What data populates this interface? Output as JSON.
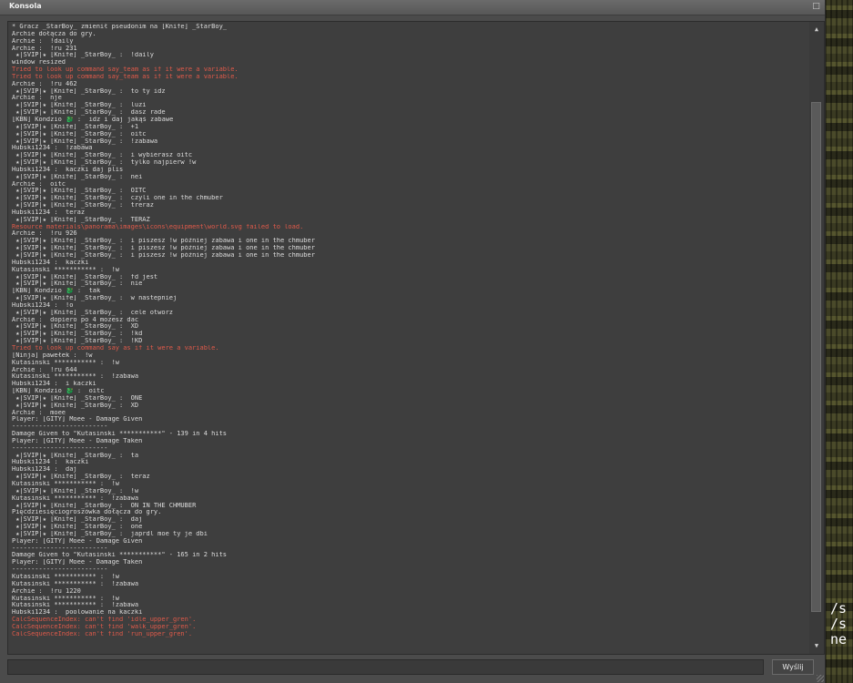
{
  "window": {
    "title": "Konsola",
    "close_icon": "□",
    "submit_label": "Wyślij",
    "input_value": ""
  },
  "game": {
    "text": "/s\n/s\nne"
  },
  "scrollbar": {
    "up_icon": "▲",
    "down_icon": "▼",
    "position_fraction": 0.85
  },
  "colors": {
    "error": "#e05a4a",
    "normal": "#dcdcdc"
  },
  "log": [
    {
      "t": "* Gracz _StarBoy_ zmienił pseudonim na [Knife] _StarBoy_",
      "e": false
    },
    {
      "t": "Archie dołącza do gry.",
      "e": false
    },
    {
      "t": "Archie :  !daily",
      "e": false
    },
    {
      "t": "Archie :  !ru 231",
      "e": false
    },
    {
      "t": " ★|SVIP|★ [Knife] _StarBoy_ :  !daily",
      "e": false
    },
    {
      "t": "window resized",
      "e": false
    },
    {
      "t": "Tried to look up command say_team as if it were a variable.",
      "e": true
    },
    {
      "t": "Tried to look up command say_team as if it were a variable.",
      "e": true
    },
    {
      "t": "Archie :  !ru 462",
      "e": false
    },
    {
      "t": " ★|SVIP|★ [Knife] _StarBoy_ :  to ty idz",
      "e": false
    },
    {
      "t": "Archie :  nje",
      "e": false
    },
    {
      "t": " ★|SVIP|★ [Knife] _StarBoy_ :  luzi",
      "e": false
    },
    {
      "t": " ★|SVIP|★ [Knife] _StarBoy_ :  dasz rade",
      "e": false
    },
    {
      "t": "[KBN] Kondzio 🐉 :  idz i daj jakąś zabawe",
      "e": false
    },
    {
      "t": " ★|SVIP|★ [Knife] _StarBoy_ :  +1",
      "e": false
    },
    {
      "t": " ★|SVIP|★ [Knife] _StarBoy_ :  oitc",
      "e": false
    },
    {
      "t": " ★|SVIP|★ [Knife] _StarBoy_ :  !zabawa",
      "e": false
    },
    {
      "t": "Hubski1234 :  !zabawa",
      "e": false
    },
    {
      "t": " ★|SVIP|★ [Knife] _StarBoy_ :  i wybierasz oitc",
      "e": false
    },
    {
      "t": " ★|SVIP|★ [Knife] _StarBoy_ :  tylko najpierw !w",
      "e": false
    },
    {
      "t": "Hubski1234 :  kaczki daj plis",
      "e": false
    },
    {
      "t": " ★|SVIP|★ [Knife] _StarBoy_ :  nei",
      "e": false
    },
    {
      "t": "Archie :  oitc",
      "e": false
    },
    {
      "t": " ★|SVIP|★ [Knife] _StarBoy_ :  OITC",
      "e": false
    },
    {
      "t": " ★|SVIP|★ [Knife] _StarBoy_ :  czyli one in the chmuber",
      "e": false
    },
    {
      "t": " ★|SVIP|★ [Knife] _StarBoy_ :  treraz",
      "e": false
    },
    {
      "t": "Hubski1234 :  teraz",
      "e": false
    },
    {
      "t": " ★|SVIP|★ [Knife] _StarBoy_ :  TERAZ",
      "e": false
    },
    {
      "t": "Resource materials\\panorama\\images\\icons\\equipment\\world.svg failed to load.",
      "e": true
    },
    {
      "t": "Archie :  !ru 926",
      "e": false
    },
    {
      "t": " ★|SVIP|★ [Knife] _StarBoy_ :  i piszesz !w później zabawa i one in the chmuber",
      "e": false
    },
    {
      "t": " ★|SVIP|★ [Knife] _StarBoy_ :  i piszesz !w później zabawa i one in the chmuber",
      "e": false
    },
    {
      "t": " ★|SVIP|★ [Knife] _StarBoy_ :  i piszesz !w później zabawa i one in the chmuber",
      "e": false
    },
    {
      "t": "Hubski1234 :  kaczki",
      "e": false
    },
    {
      "t": "Kutasinski *********** :  !w",
      "e": false
    },
    {
      "t": " ★|SVIP|★ [Knife] _StarBoy_ :  fd jest",
      "e": false
    },
    {
      "t": " ★|SVIP|★ [Knife] _StarBoy_ :  nie",
      "e": false
    },
    {
      "t": "[KBN] Kondzio 🐉 :  tak",
      "e": false
    },
    {
      "t": " ★|SVIP|★ [Knife] _StarBoy_ :  w nastepniej",
      "e": false
    },
    {
      "t": "Hubski1234 :  !o",
      "e": false
    },
    {
      "t": " ★|SVIP|★ [Knife] _StarBoy_ :  cele otworz",
      "e": false
    },
    {
      "t": "Archie :  dopiero po 4 mozesz dac",
      "e": false
    },
    {
      "t": " ★|SVIP|★ [Knife] _StarBoy_ :  XD",
      "e": false
    },
    {
      "t": " ★|SVIP|★ [Knife] _StarBoy_ :  !kd",
      "e": false
    },
    {
      "t": " ★|SVIP|★ [Knife] _StarBoy_ :  !KD",
      "e": false
    },
    {
      "t": "Tried to look up command say as if it were a variable.",
      "e": true
    },
    {
      "t": "[Ninja] pawełek :  !w",
      "e": false
    },
    {
      "t": "Kutasinski *********** :  !w",
      "e": false
    },
    {
      "t": "Archie :  !ru 644",
      "e": false
    },
    {
      "t": "Kutasinski *********** :  !zabawa",
      "e": false
    },
    {
      "t": "Hubski1234 :  i kaczki",
      "e": false
    },
    {
      "t": "[KBN] Kondzio 🐉 :  oitc",
      "e": false
    },
    {
      "t": " ★|SVIP|★ [Knife] _StarBoy_ :  ONE",
      "e": false
    },
    {
      "t": " ★|SVIP|★ [Knife] _StarBoy_ :  XD",
      "e": false
    },
    {
      "t": "Archie :  moee",
      "e": false
    },
    {
      "t": "Player: [GITY] Moee - Damage Given",
      "e": false
    },
    {
      "t": "-------------------------",
      "e": false
    },
    {
      "t": "Damage Given to \"Kutasinski ***********\" - 139 in 4 hits",
      "e": false
    },
    {
      "t": "Player: [GITY] Moee - Damage Taken",
      "e": false
    },
    {
      "t": "-------------------------",
      "e": false
    },
    {
      "t": " ★|SVIP|★ [Knife] _StarBoy_ :  ta",
      "e": false
    },
    {
      "t": "Hubski1234 :  kaczki",
      "e": false
    },
    {
      "t": "Hubski1234 :  daj",
      "e": false
    },
    {
      "t": " ★|SVIP|★ [Knife] _StarBoy_ :  teraz",
      "e": false
    },
    {
      "t": "Kutasinski *********** :  !w",
      "e": false
    },
    {
      "t": " ★|SVIP|★ [Knife] _StarBoy_ :  !w",
      "e": false
    },
    {
      "t": "Kutasinski *********** :  !zabawa",
      "e": false
    },
    {
      "t": " ★|SVIP|★ [Knife] _StarBoy_ :  ON IN THE CHMUBER",
      "e": false
    },
    {
      "t": "Pięćdziesięciogroszówka dołącza do gry.",
      "e": false
    },
    {
      "t": " ★|SVIP|★ [Knife] _StarBoy_ :  daj",
      "e": false
    },
    {
      "t": " ★|SVIP|★ [Knife] _StarBoy_ :  one",
      "e": false
    },
    {
      "t": " ★|SVIP|★ [Knife] _StarBoy_ :  japrdl moe ty je dbi",
      "e": false
    },
    {
      "t": "Player: [GITY] Moee - Damage Given",
      "e": false
    },
    {
      "t": "-------------------------",
      "e": false
    },
    {
      "t": "Damage Given to \"Kutasinski ***********\" - 165 in 2 hits",
      "e": false
    },
    {
      "t": "Player: [GITY] Moee - Damage Taken",
      "e": false
    },
    {
      "t": "-------------------------",
      "e": false
    },
    {
      "t": "Kutasinski *********** :  !w",
      "e": false
    },
    {
      "t": "Kutasinski *********** :  !zabawa",
      "e": false
    },
    {
      "t": "Archie :  !ru 1220",
      "e": false
    },
    {
      "t": "Kutasinski *********** :  !w",
      "e": false
    },
    {
      "t": "Kutasinski *********** :  !zabawa",
      "e": false
    },
    {
      "t": "Hubski1234 :  poolowanie na kaczki",
      "e": false
    },
    {
      "t": "CalcSequenceIndex: can't find 'idle_upper_gren'.",
      "e": true
    },
    {
      "t": "CalcSequenceIndex: can't find 'walk_upper_gren'.",
      "e": true
    },
    {
      "t": "CalcSequenceIndex: can't find 'run_upper_gren'.",
      "e": true
    }
  ]
}
